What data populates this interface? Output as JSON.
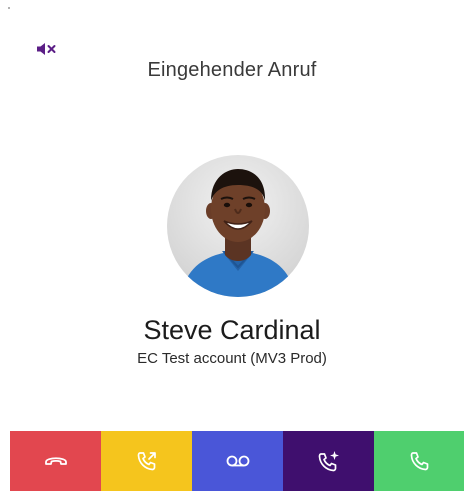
{
  "call": {
    "title": "Eingehender Anruf",
    "caller_name": "Steve Cardinal",
    "caller_account": "EC Test account (MV3 Prod)",
    "mute_icon": "speaker-muted-icon",
    "accent_color": "#5b1e86"
  },
  "actions": [
    {
      "name": "decline",
      "icon": "hang-up-icon",
      "color": "#e2474f"
    },
    {
      "name": "forward",
      "icon": "call-forward-icon",
      "color": "#f5c51d"
    },
    {
      "name": "voicemail",
      "icon": "voicemail-icon",
      "color": "#4a56d8"
    },
    {
      "name": "smart-answer",
      "icon": "call-sparkle-icon",
      "color": "#3f0f6e"
    },
    {
      "name": "accept",
      "icon": "phone-icon",
      "color": "#4fcf6e"
    }
  ]
}
